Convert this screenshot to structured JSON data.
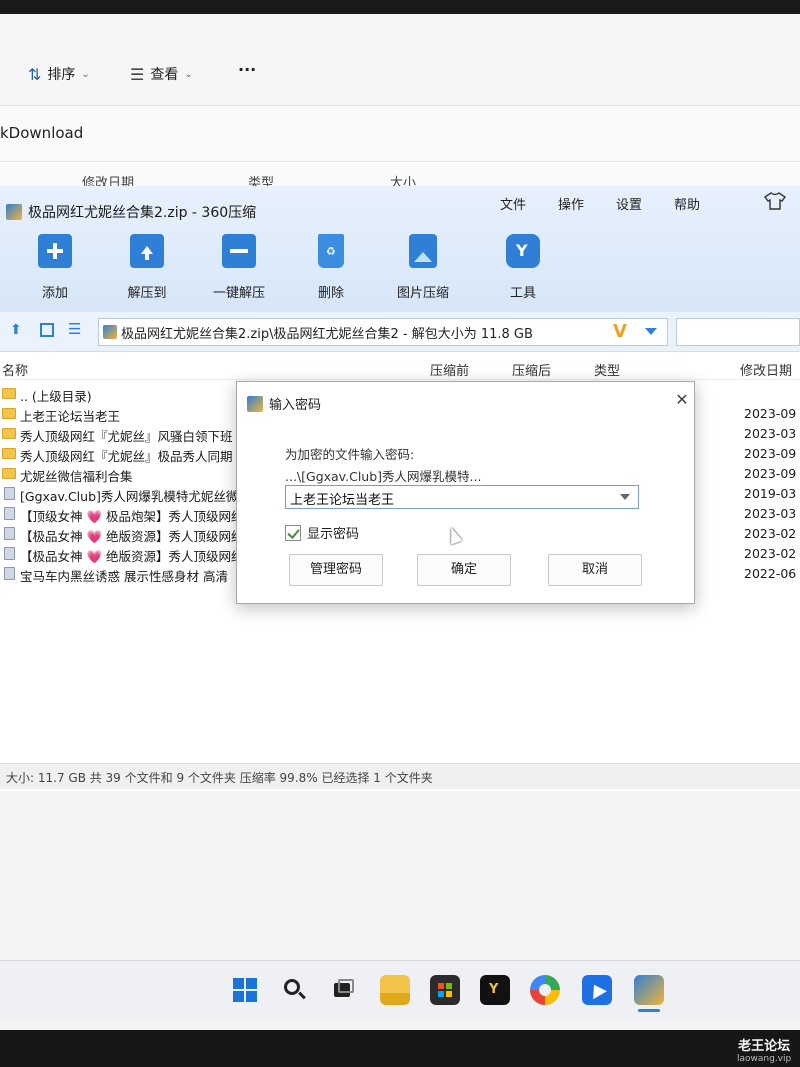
{
  "explorer": {
    "sort_label": "排序",
    "view_label": "查看",
    "more_label": "···",
    "path_text": "kDownload",
    "columns": [
      "修改日期",
      "类型",
      "大小"
    ]
  },
  "zip": {
    "title": "极品网红尤妮丝合集2.zip - 360压缩",
    "menu": [
      "文件",
      "操作",
      "设置",
      "帮助"
    ],
    "tools": [
      {
        "label": "添加",
        "icon": "add-icon"
      },
      {
        "label": "解压到",
        "icon": "extract-to-icon"
      },
      {
        "label": "一键解压",
        "icon": "quick-extract-icon"
      },
      {
        "label": "删除",
        "icon": "delete-icon"
      },
      {
        "label": "图片压缩",
        "icon": "image-compress-icon"
      },
      {
        "label": "工具",
        "icon": "tools-icon"
      }
    ],
    "address": "极品网红尤妮丝合集2.zip\\极品网红尤妮丝合集2 - 解包大小为 11.8 GB",
    "columns": {
      "name": "名称",
      "packed": "压缩前",
      "compressed": "压缩后",
      "type": "类型",
      "modified": "修改日期"
    },
    "rows": [
      {
        "name": ".. (上级目录)",
        "date": "",
        "kind": "folder"
      },
      {
        "name": "上老王论坛当老王",
        "date": "2023-09",
        "kind": "folder"
      },
      {
        "name": "秀人顶级网红『尤妮丝』风骚白领下班",
        "date": "2023-03",
        "kind": "folder"
      },
      {
        "name": "秀人顶级网红『尤妮丝』极品秀人同期",
        "date": "2023-09",
        "kind": "folder"
      },
      {
        "name": "尤妮丝微信福利合集",
        "date": "2023-09",
        "kind": "folder"
      },
      {
        "name": "[Ggxav.Club]秀人网爆乳模特尤妮丝微",
        "date": "2019-03",
        "kind": "file"
      },
      {
        "name": "【顶级女神 💗 极品炮架】秀人顶级网红",
        "date": "2023-03",
        "kind": "file"
      },
      {
        "name": "【极品女神 💗 绝版资源】秀人顶级网红",
        "date": "2023-02",
        "kind": "file"
      },
      {
        "name": "【极品女神 💗 绝版资源】秀人顶级网红",
        "date": "2023-02",
        "kind": "file"
      },
      {
        "name": "宝马车内黑丝诱惑 展示性感身材 高清",
        "date": "2022-06",
        "kind": "file"
      }
    ],
    "status": "大小: 11.7 GB 共 39 个文件和 9 个文件夹 压缩率 99.8% 已经选择 1 个文件夹"
  },
  "dialog": {
    "title": "输入密码",
    "hint": "为加密的文件输入密码:",
    "file_path": "...\\[Ggxav.Club]秀人网爆乳模特...",
    "password_value": "上老王论坛当老王",
    "show_password_label": "显示密码",
    "show_password_checked": true,
    "manage_button": "管理密码",
    "ok_button": "确定",
    "cancel_button": "取消",
    "close_glyph": "✕"
  },
  "taskbar": {
    "icons": [
      "windows-start-icon",
      "search-icon",
      "task-view-icon",
      "file-explorer-icon",
      "microsoft-store-icon",
      "app-icon",
      "browser-icon",
      "feishu-icon",
      "360zip-icon"
    ]
  },
  "watermark": {
    "title": "老王论坛",
    "url": "laowang.vip"
  }
}
